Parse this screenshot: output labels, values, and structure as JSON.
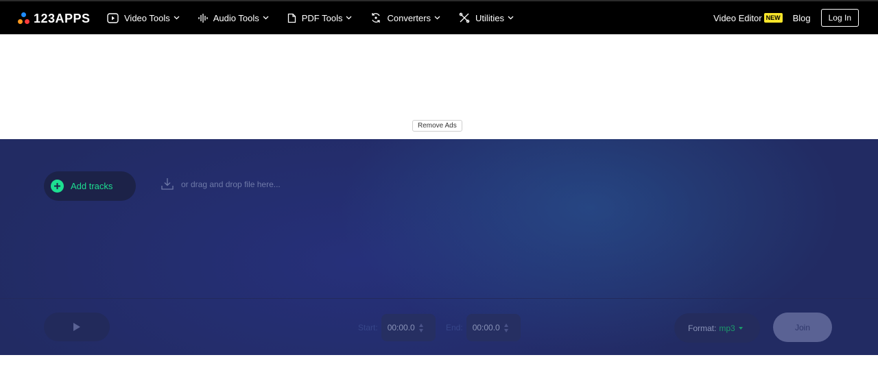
{
  "header": {
    "logo_text": "123APPS",
    "nav": [
      {
        "label": "Video Tools",
        "icon": "play-square-icon"
      },
      {
        "label": "Audio Tools",
        "icon": "waveform-icon"
      },
      {
        "label": "PDF Tools",
        "icon": "document-icon"
      },
      {
        "label": "Converters",
        "icon": "convert-icon"
      },
      {
        "label": "Utilities",
        "icon": "tools-icon"
      }
    ],
    "video_editor_label": "Video Editor",
    "new_badge": "NEW",
    "blog_label": "Blog",
    "login_label": "Log In"
  },
  "ads": {
    "remove_ads_label": "Remove Ads"
  },
  "tool": {
    "add_tracks_label": "Add tracks",
    "dropzone_text": "or drag and drop file here...",
    "start_label": "Start:",
    "start_value": "00:00.0",
    "end_label": "End:",
    "end_value": "00:00.0",
    "format_label": "Format:",
    "format_value": "mp3",
    "join_label": "Join"
  },
  "colors": {
    "accent_green": "#1ddf91",
    "header_bg": "#000000",
    "app_bg": "#222b63",
    "new_badge": "#f8e52a"
  }
}
